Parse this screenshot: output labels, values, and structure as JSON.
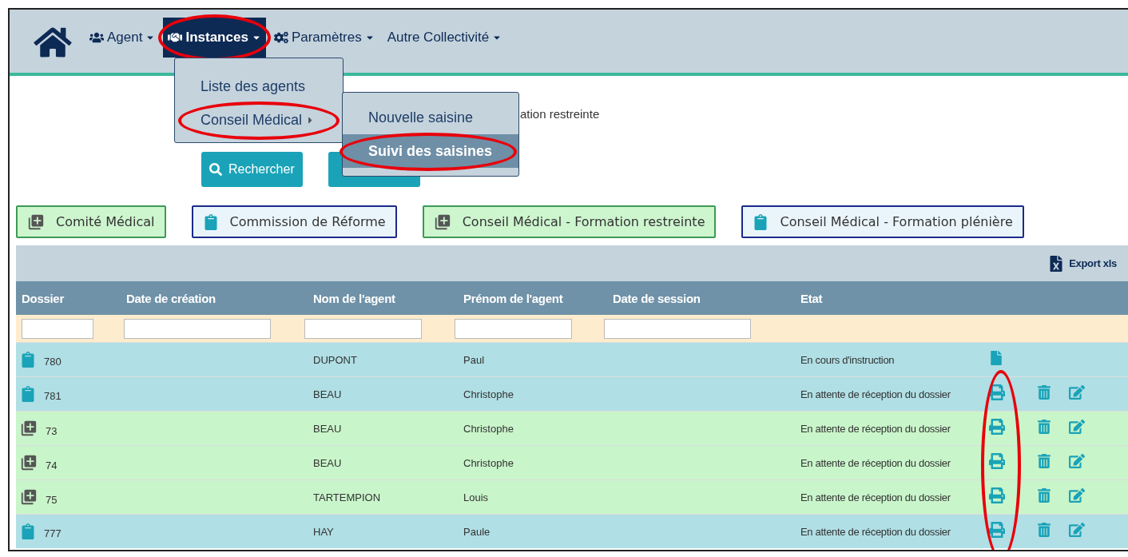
{
  "navbar": {
    "items": [
      {
        "label": "Agent",
        "selected": false,
        "highlighted": false
      },
      {
        "label": "Instances",
        "selected": true,
        "highlighted": true
      },
      {
        "label": "Paramètres",
        "selected": false,
        "highlighted": false
      },
      {
        "label": "Autre Collectivité",
        "selected": false,
        "highlighted": false
      }
    ]
  },
  "menu": {
    "items": [
      {
        "label": "Liste des agents",
        "submenu": false,
        "highlighted": false
      },
      {
        "label": "Conseil Médical",
        "submenu": true,
        "highlighted": true
      }
    ]
  },
  "submenu": {
    "items": [
      {
        "label": "Nouvelle saisine",
        "selected": false,
        "highlighted": false
      },
      {
        "label": "Suivi des saisines",
        "selected": true,
        "highlighted": true
      }
    ]
  },
  "background_line": "ation restreinte",
  "search_button": "Rechercher",
  "filters": [
    {
      "label": "Comité Médical",
      "kind": "copy-plus"
    },
    {
      "label": "Commission de Réforme",
      "kind": "clipboard"
    },
    {
      "label": "Conseil Médical - Formation restreinte",
      "kind": "copy-plus"
    },
    {
      "label": "Conseil Médical - Formation plénière",
      "kind": "clipboard"
    }
  ],
  "export": "Export xls",
  "table": {
    "columns": [
      "Dossier",
      "Date de création",
      "Nom de l'agent",
      "Prénom de l'agent",
      "Date de session",
      "Etat"
    ],
    "print_column_highlighted": true,
    "rows": [
      {
        "kind": "clipboard",
        "dossier": "780",
        "nom": "DUPONT",
        "prenom": "Paul",
        "etat": "En cours d'instruction",
        "document": true,
        "printable": false,
        "deletable": false,
        "editable": false
      },
      {
        "kind": "clipboard",
        "dossier": "781",
        "nom": "BEAU",
        "prenom": "Christophe",
        "etat": "En attente de réception du dossier",
        "document": false,
        "printable": true,
        "deletable": true,
        "editable": true
      },
      {
        "kind": "copy-plus",
        "dossier": "73",
        "nom": "BEAU",
        "prenom": "Christophe",
        "etat": "En attente de réception du dossier",
        "document": false,
        "printable": true,
        "deletable": true,
        "editable": true
      },
      {
        "kind": "copy-plus",
        "dossier": "74",
        "nom": "BEAU",
        "prenom": "Christophe",
        "etat": "En attente de réception du dossier",
        "document": false,
        "printable": true,
        "deletable": true,
        "editable": true
      },
      {
        "kind": "copy-plus",
        "dossier": "75",
        "nom": "TARTEMPION",
        "prenom": "Louis",
        "etat": "En attente de réception du dossier",
        "document": false,
        "printable": true,
        "deletable": true,
        "editable": true
      },
      {
        "kind": "clipboard",
        "dossier": "777",
        "nom": "HAY",
        "prenom": "Paule",
        "etat": "En attente de réception du dossier",
        "document": false,
        "printable": true,
        "deletable": true,
        "editable": true
      }
    ]
  }
}
